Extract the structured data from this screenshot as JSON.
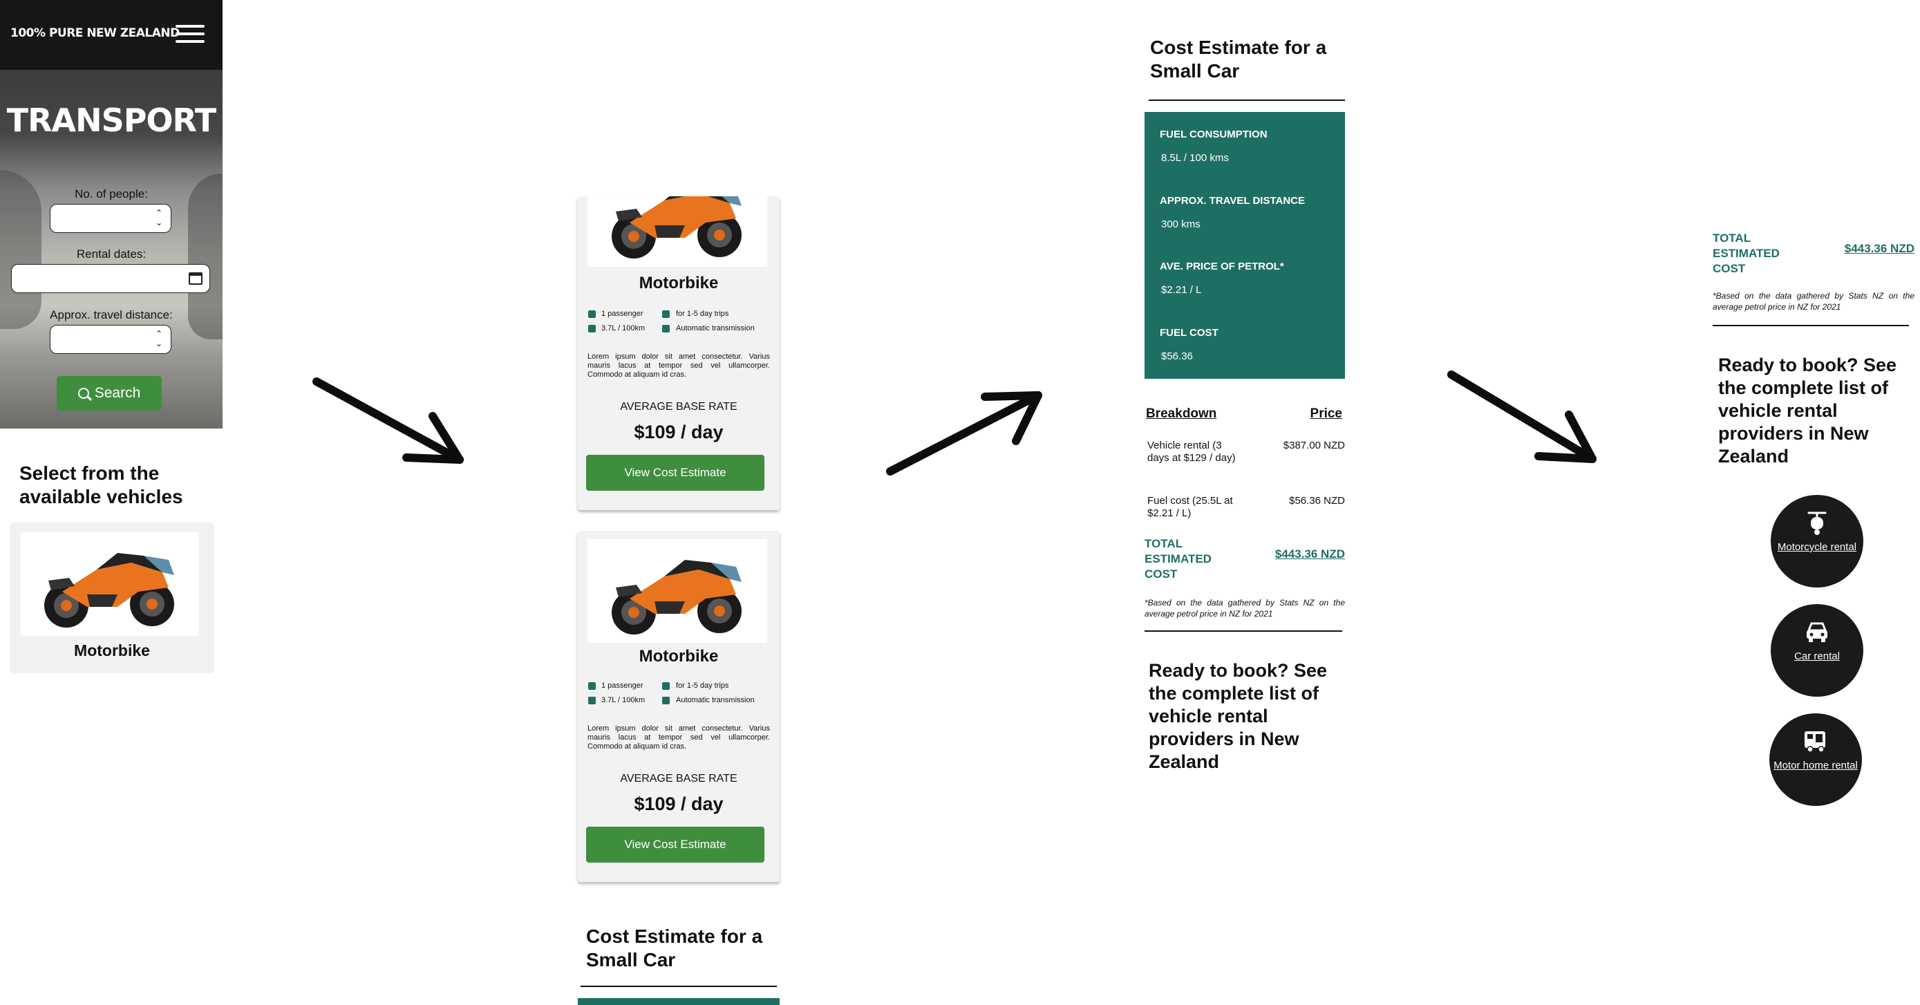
{
  "header": {
    "brand": "100% PURE NEW ZEALAND",
    "menu_icon": "hamburger-menu-icon"
  },
  "hero": {
    "title": "TRANSPORT"
  },
  "search_form": {
    "people_label": "No. of people:",
    "people_value": "",
    "dates_label": "Rental dates:",
    "dates_value": "",
    "distance_label": "Approx. travel distance:",
    "distance_value": "",
    "search_button": "Search"
  },
  "selection": {
    "title": "Select from the available vehicles",
    "vehicle_name": "Motorbike"
  },
  "vehicle_cards": [
    {
      "name": "Motorbike",
      "passengers": "1 passenger",
      "trip_length": "for 1-5 day trips",
      "fuel": "3.7L / 100km",
      "transmission": "Automatic transmission",
      "description": "Lorem ipsum dolor sit amet consectetur. Varius mauris lacus at tempor sed vel ullamcorper. Commodo at aliquam id cras.",
      "rate_label": "AVERAGE BASE RATE",
      "rate": "$109 / day",
      "button": "View Cost Estimate"
    },
    {
      "name": "Motorbike",
      "passengers": "1 passenger",
      "trip_length": "for 1-5 day trips",
      "fuel": "3.7L / 100km",
      "transmission": "Automatic transmission",
      "description": "Lorem ipsum dolor sit amet consectetur. Varius mauris lacus at tempor sed vel ullamcorper. Commodo at aliquam id cras.",
      "rate_label": "AVERAGE BASE RATE",
      "rate": "$109 / day",
      "button": "View Cost Estimate"
    }
  ],
  "estimate": {
    "title": "Cost Estimate for a Small Car",
    "fuel_consumption_label": "FUEL CONSUMPTION",
    "fuel_consumption_value": "8.5L / 100 kms",
    "distance_label": "APPROX. TRAVEL DISTANCE",
    "distance_value": "300 kms",
    "petrol_label": "AVE. PRICE OF PETROL*",
    "petrol_value": "$2.21 / L",
    "fuel_cost_label": "FUEL COST",
    "fuel_cost_value": "$56.36",
    "breakdown_header": "Breakdown",
    "price_header": "Price",
    "items": [
      {
        "label": "Vehicle rental (3 days at $129 / day)",
        "price": "$387.00 NZD"
      },
      {
        "label": "Fuel cost (25.5L at $2.21 / L)",
        "price": "$56.36 NZD"
      }
    ],
    "total_label": "TOTAL ESTIMATED COST",
    "total_value": "$443.36 NZD",
    "note": "*Based on the data gathered by Stats NZ on the average petrol price in NZ for 2021"
  },
  "booking": {
    "title": "Ready to book? See the complete list of vehicle rental providers in New Zealand",
    "options": [
      {
        "icon": "scooter-icon",
        "label": "Motorcycle rental"
      },
      {
        "icon": "car-icon",
        "label": "Car rental"
      },
      {
        "icon": "motorhome-icon",
        "label": "Motor home rental"
      }
    ]
  },
  "colors": {
    "teal": "#1e6f63",
    "green_button": "#3e8e3d",
    "dark": "#161616"
  }
}
